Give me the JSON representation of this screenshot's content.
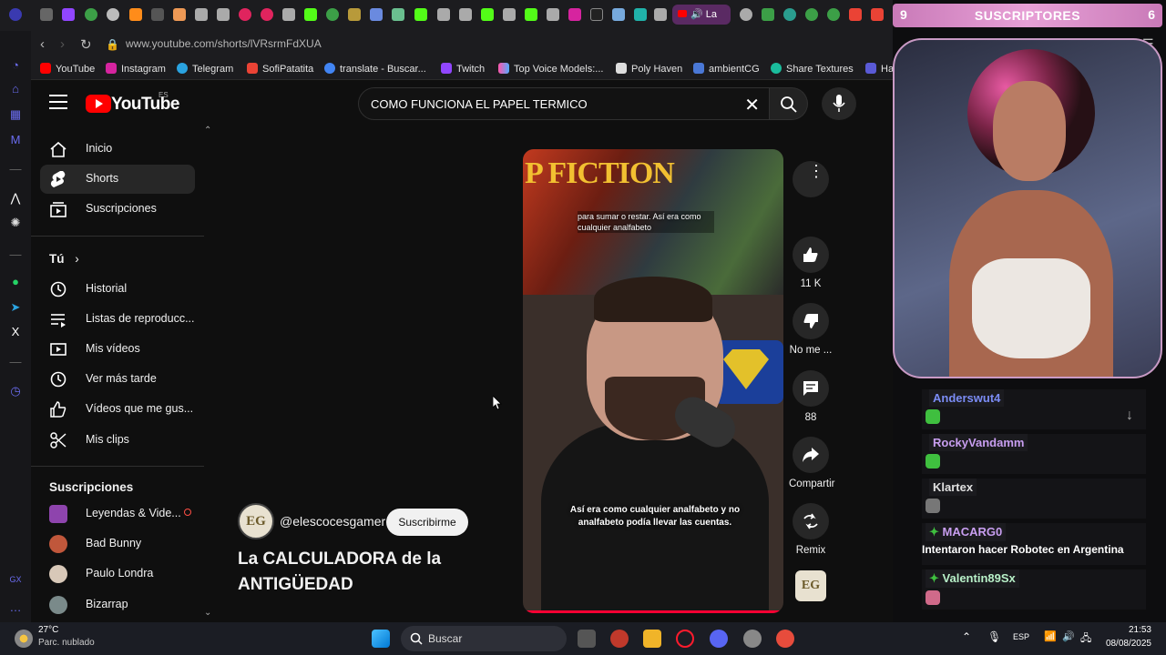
{
  "browser": {
    "active_tab_label": "La",
    "url": "www.youtube.com/shorts/lVRsrmFdXUA",
    "bookmarks": [
      "YouTube",
      "Instagram",
      "Telegram",
      "SofiPatatita",
      "translate - Buscar...",
      "Twitch",
      "Top Voice Models:...",
      "Poly Haven",
      "ambientCG",
      "Share Textures",
      "Har"
    ]
  },
  "youtube": {
    "logo_text": "YouTube",
    "logo_country": "ES",
    "search_query": "COMO FUNCIONA EL PAPEL TERMICO",
    "sidebar": {
      "main": [
        {
          "label": "Inicio",
          "icon": "home-icon"
        },
        {
          "label": "Shorts",
          "icon": "shorts-icon"
        },
        {
          "label": "Suscripciones",
          "icon": "subscriptions-icon"
        }
      ],
      "you_heading": "Tú",
      "you": [
        {
          "label": "Historial",
          "icon": "history-icon"
        },
        {
          "label": "Listas de reproducc...",
          "icon": "playlists-icon"
        },
        {
          "label": "Mis vídeos",
          "icon": "my-videos-icon"
        },
        {
          "label": "Ver más tarde",
          "icon": "watch-later-icon"
        },
        {
          "label": "Vídeos que me gus...",
          "icon": "liked-icon"
        },
        {
          "label": "Mis clips",
          "icon": "clips-icon"
        }
      ],
      "subs_heading": "Suscripciones",
      "subscriptions": [
        {
          "label": "Leyendas & Vide...",
          "live": true
        },
        {
          "label": "Bad Bunny",
          "live": false
        },
        {
          "label": "Paulo Londra",
          "live": false
        },
        {
          "label": "Bizarrap",
          "live": false
        }
      ]
    },
    "short": {
      "caption_top": "para sumar o restar. Así era como cualquier analfabeto",
      "caption_bottom": "Así era como cualquier analfabeto y no analfabeto podía llevar las cuentas.",
      "channel": "@elescocesgamer",
      "subscribe_label": "Suscribirme",
      "title": "La CALCULADORA de la ANTIGÜEDAD",
      "likes": "11 K",
      "dislike_label": "No me ...",
      "comments": "88",
      "share_label": "Compartir",
      "remix_label": "Remix"
    }
  },
  "stream": {
    "subs_left": "9",
    "subs_title": "SUSCRIPTORES",
    "subs_right": "6",
    "chat": [
      {
        "user": "Anderswut4",
        "color": "#7b8cf5",
        "text": ""
      },
      {
        "user": "RockyVandamm",
        "color": "#c89ef0",
        "text": ""
      },
      {
        "user": "Klartex",
        "color": "#e0e0e0",
        "text": ""
      },
      {
        "user": "MACARG0",
        "color": "#c89ef0",
        "text": "Intentaron hacer Robotec en Argentina"
      },
      {
        "user": "Valentin89Sx",
        "color": "#b8f0c8",
        "text": ""
      }
    ]
  },
  "taskbar": {
    "temp": "27°C",
    "weather": "Parc. nublado",
    "search_placeholder": "Buscar",
    "lang": "ESP",
    "time": "21:53",
    "date": "08/08/2025"
  }
}
